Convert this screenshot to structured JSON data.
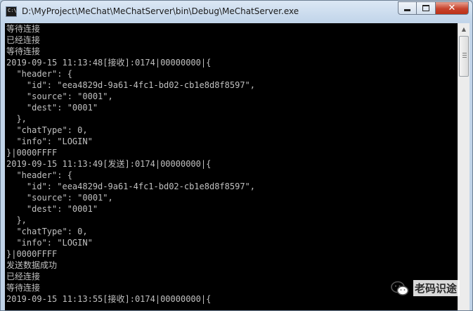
{
  "window": {
    "title": "D:\\MyProject\\MeChat\\MeChatServer\\bin\\Debug\\MeChatServer.exe",
    "icon": "console-app-icon"
  },
  "console": {
    "lines": [
      "等待连接",
      "已经连接",
      "等待连接",
      "2019-09-15 11:13:48[接收]:0174|00000000|{",
      "  \"header\": {",
      "    \"id\": \"eea4829d-9a61-4fc1-bd02-cb1e8d8f8597\",",
      "    \"source\": \"0001\",",
      "    \"dest\": \"0001\"",
      "  },",
      "  \"chatType\": 0,",
      "  \"info\": \"LOGIN\"",
      "}|0000FFFF",
      "2019-09-15 11:13:49[发送]:0174|00000000|{",
      "  \"header\": {",
      "    \"id\": \"eea4829d-9a61-4fc1-bd02-cb1e8d8f8597\",",
      "    \"source\": \"0001\",",
      "    \"dest\": \"0001\"",
      "  },",
      "  \"chatType\": 0,",
      "  \"info\": \"LOGIN\"",
      "}|0000FFFF",
      "发送数据成功",
      "已经连接",
      "等待连接",
      "2019-09-15 11:13:55[接收]:0174|00000000|{"
    ]
  },
  "watermark": {
    "text": "老码识途",
    "icon": "wechat-icon"
  }
}
